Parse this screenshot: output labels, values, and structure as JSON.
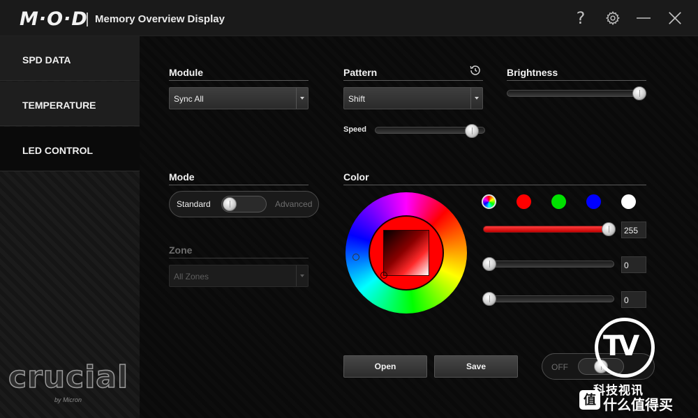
{
  "app": {
    "logo": "M·O·D",
    "title": "Memory Overview Display"
  },
  "titlebar": {
    "help": "?",
    "icons": [
      "help-icon",
      "gear-icon",
      "minimize-icon",
      "close-icon"
    ]
  },
  "sidebar": {
    "items": [
      {
        "label": "SPD DATA",
        "active": false
      },
      {
        "label": "TEMPERATURE",
        "active": false
      },
      {
        "label": "LED CONTROL",
        "active": true
      }
    ],
    "brand": "crucial",
    "brand_sub": "by Micron"
  },
  "module": {
    "label": "Module",
    "selected": "Sync All"
  },
  "pattern": {
    "label": "Pattern",
    "selected": "Shift",
    "speed_label": "Speed",
    "speed_level": 1.0
  },
  "brightness": {
    "label": "Brightness",
    "level": 1.0
  },
  "mode": {
    "label": "Mode",
    "left": "Standard",
    "right": "Advanced",
    "value": "Standard"
  },
  "zone": {
    "label": "Zone",
    "selected": "All Zones",
    "disabled": true
  },
  "color": {
    "label": "Color",
    "swatches": [
      {
        "name": "rainbow",
        "color": "conic"
      },
      {
        "name": "red",
        "color": "#ff0000"
      },
      {
        "name": "green",
        "color": "#00e000"
      },
      {
        "name": "blue",
        "color": "#0000ff"
      },
      {
        "name": "white",
        "color": "#ffffff"
      }
    ],
    "rgb": {
      "r": "255",
      "g": "0",
      "b": "0"
    },
    "current": "#ff0000"
  },
  "buttons": {
    "open": "Open",
    "save": "Save"
  },
  "power": {
    "off_label": "OFF"
  },
  "watermark": {
    "letters": "TV",
    "cn_top": "科技视讯",
    "cn_bottom": "什么值得买",
    "badge": "值"
  }
}
